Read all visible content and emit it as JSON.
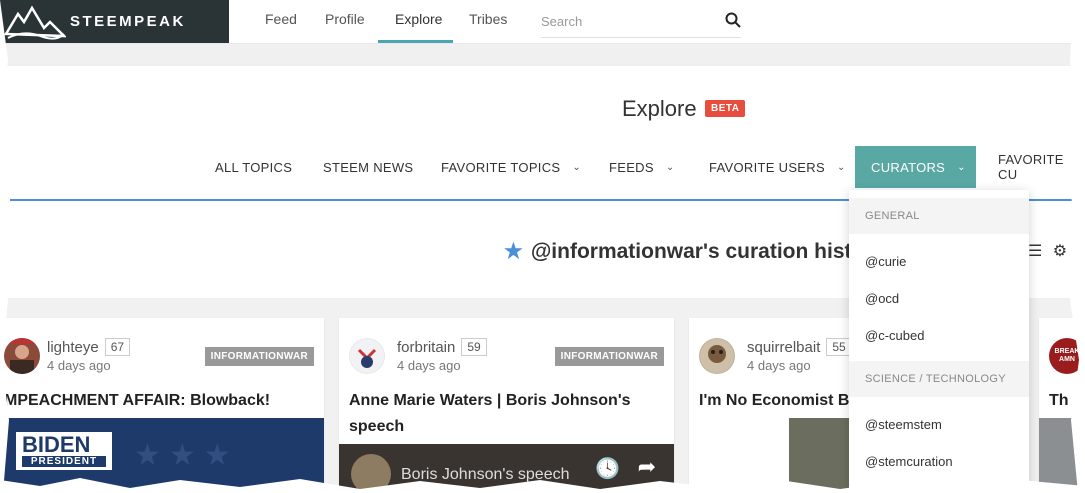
{
  "app": {
    "name": "STEEMPEAK"
  },
  "nav": {
    "links": [
      "Feed",
      "Profile",
      "Explore",
      "Tribes"
    ],
    "active": "Explore",
    "search_placeholder": "Search"
  },
  "header": {
    "title": "Explore",
    "badge": "BETA"
  },
  "tabs": [
    {
      "label": "ALL TOPICS",
      "has_chevron": false
    },
    {
      "label": "STEEM NEWS",
      "has_chevron": false
    },
    {
      "label": "FAVORITE TOPICS",
      "has_chevron": true
    },
    {
      "label": "FEEDS",
      "has_chevron": true
    },
    {
      "label": "FAVORITE USERS",
      "has_chevron": true
    },
    {
      "label": "CURATORS",
      "has_chevron": true,
      "active": true
    },
    {
      "label": "FAVORITE CU",
      "has_chevron": false
    }
  ],
  "curation": {
    "title": "@informationwar's curation histor"
  },
  "cards": [
    {
      "author": "lighteye",
      "rep": "67",
      "time": "4 days ago",
      "tag": "INFORMATIONWAR",
      "title_lines": [
        "MPEACHMENT AFFAIR: Blowback!"
      ],
      "thumb_text_1": "BIDEN",
      "thumb_text_2": "PRESIDENT"
    },
    {
      "author": "forbritain",
      "rep": "59",
      "time": "4 days ago",
      "tag": "INFORMATIONWAR",
      "title_lines": [
        "Anne Marie Waters | Boris Johnson's",
        "speech"
      ],
      "thumb_text_1": "Boris Johnson's speech"
    },
    {
      "author": "squirrelbait",
      "rep": "55",
      "time": "4 days ago",
      "tag": "",
      "title_lines": [
        "I'm No Economist B"
      ]
    },
    {
      "author": "",
      "rep": "",
      "time": "",
      "tag": "",
      "title_lines": [
        "Th"
      ],
      "avatar_text": "BREAK AMN"
    }
  ],
  "dropdown": {
    "groups": [
      {
        "label": "GENERAL",
        "items": [
          "@curie",
          "@ocd",
          "@c-cubed"
        ]
      },
      {
        "label": "SCIENCE / TECHNOLOGY",
        "items": [
          "@steemstem",
          "@stemcuration"
        ]
      }
    ]
  },
  "colors": {
    "accent": "#5aa8a3",
    "blue": "#4a90d9",
    "beta": "#e74c3c",
    "logo_bg": "#2a3436"
  }
}
